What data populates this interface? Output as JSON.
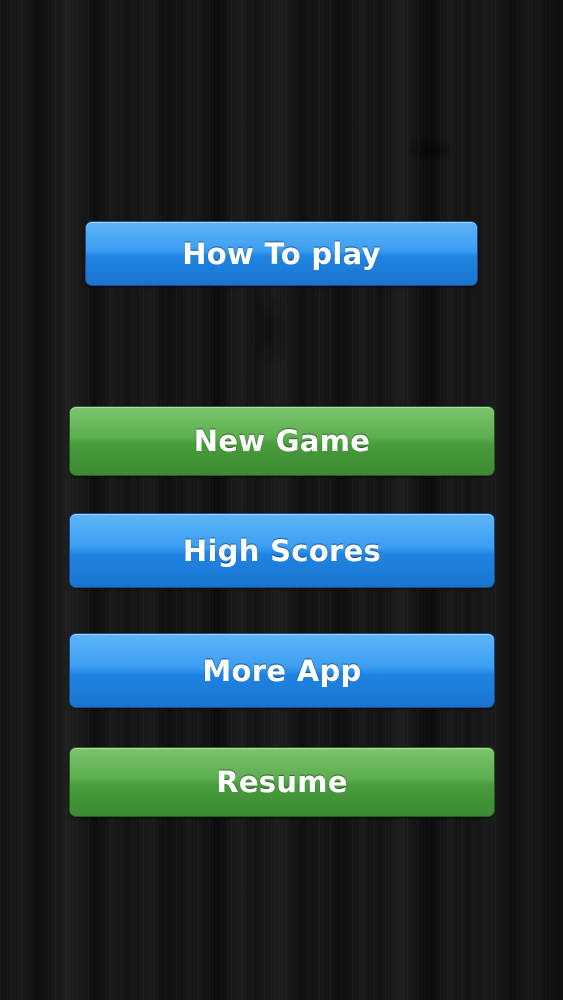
{
  "menu": {
    "how_to_play": "How To play",
    "new_game": "New Game",
    "high_scores": "High Scores",
    "more_app": "More App",
    "resume": "Resume"
  },
  "colors": {
    "background": "#141414",
    "blue_button": "#2b90e8",
    "green_button": "#52a646",
    "label": "#ffffff"
  }
}
